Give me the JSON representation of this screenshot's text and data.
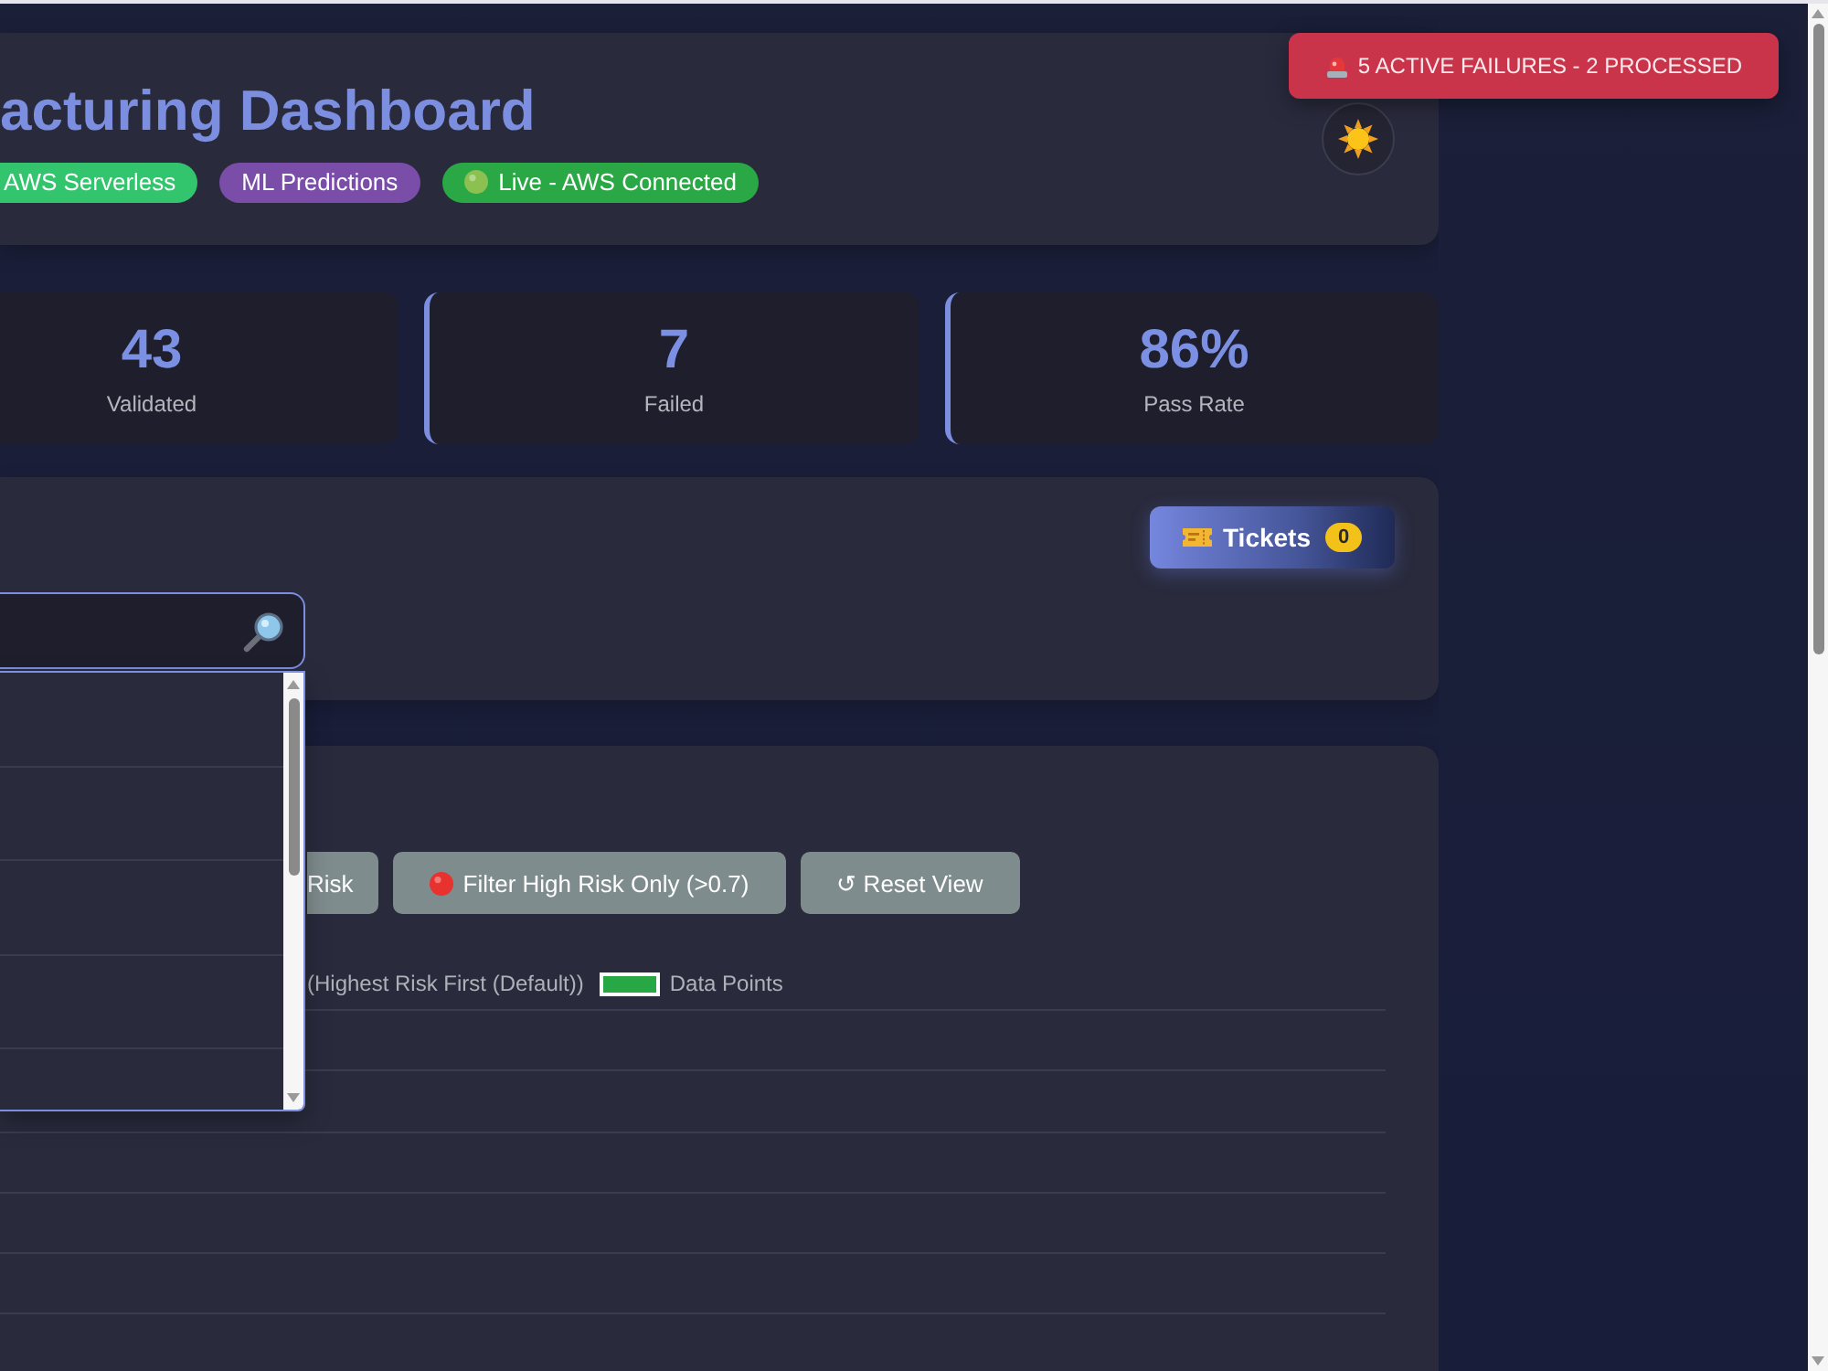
{
  "alert_banner": {
    "text": "5 ACTIVE FAILURES - 2 PROCESSED"
  },
  "header": {
    "title": "acturing Dashboard",
    "badges": [
      {
        "label": "AWS Serverless",
        "color": "#33c46e",
        "kind": "tag"
      },
      {
        "label": "ML Predictions",
        "color": "#7a4ea8",
        "kind": "tag"
      },
      {
        "label": "Live - AWS Connected",
        "color": "#2aa845",
        "kind": "status"
      }
    ]
  },
  "stats": [
    {
      "value": "43",
      "label": "Validated"
    },
    {
      "value": "7",
      "label": "Failed"
    },
    {
      "value": "86%",
      "label": "Pass Rate"
    }
  ],
  "search_panel": {
    "tickets_button": {
      "label": "Tickets",
      "count": "0"
    },
    "dropdown_expanded": true
  },
  "chart_panel": {
    "buttons": [
      {
        "label": "Risk",
        "kind": "plain"
      },
      {
        "label": "Filter High Risk Only (>0.7)",
        "kind": "filter"
      },
      {
        "label": "↺ Reset View",
        "kind": "plain"
      }
    ],
    "legend": [
      {
        "label": "(Highest Risk First (Default))"
      },
      {
        "label": "Data Points",
        "color": "#28a745"
      }
    ]
  }
}
